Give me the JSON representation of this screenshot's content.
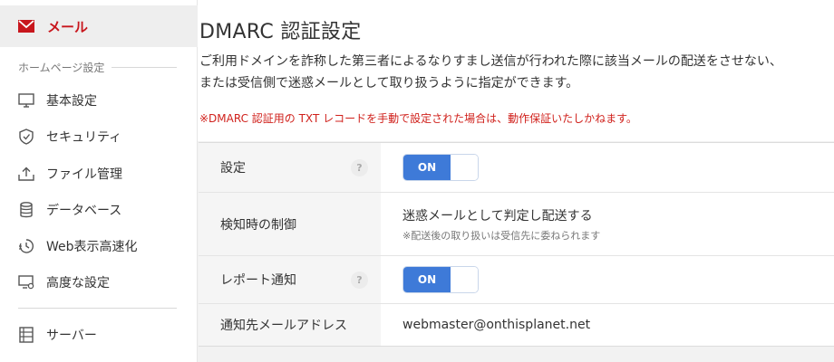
{
  "sidebar": {
    "active": {
      "label": "メール",
      "icon": "mail-icon"
    },
    "section_title": "ホームページ設定",
    "items": [
      {
        "label": "基本設定",
        "icon": "monitor-icon"
      },
      {
        "label": "セキュリティ",
        "icon": "shield-icon"
      },
      {
        "label": "ファイル管理",
        "icon": "upload-icon"
      },
      {
        "label": "データベース",
        "icon": "database-icon"
      },
      {
        "label": "Web表示高速化",
        "icon": "speed-icon"
      },
      {
        "label": "高度な設定",
        "icon": "monitor-gear-icon"
      }
    ],
    "server": {
      "label": "サーバー",
      "icon": "server-list-icon"
    }
  },
  "page": {
    "title": "DMARC 認証設定",
    "description_line1": "ご利用ドメインを詐称した第三者によるなりすまし送信が行われた際に該当メールの配送をさせない、",
    "description_line2": "または受信側で迷惑メールとして取り扱うように指定ができます。",
    "warning": "※DMARC 認証用の TXT レコードを手動で設定された場合は、動作保証いたしかねます。"
  },
  "settings": {
    "setting_label": "設定",
    "setting_toggle": "ON",
    "detection_label": "検知時の制御",
    "detection_value": "迷惑メールとして判定し配送する",
    "detection_note": "※配送後の取り扱いは受信先に委ねられます",
    "report_label": "レポート通知",
    "report_toggle": "ON",
    "address_label": "通知先メールアドレス",
    "address_value": "webmaster@onthisplanet.net",
    "help_glyph": "?"
  },
  "colors": {
    "accent_red": "#c8161d",
    "toggle_blue": "#3e7ad8",
    "warning_red": "#d0211c"
  }
}
